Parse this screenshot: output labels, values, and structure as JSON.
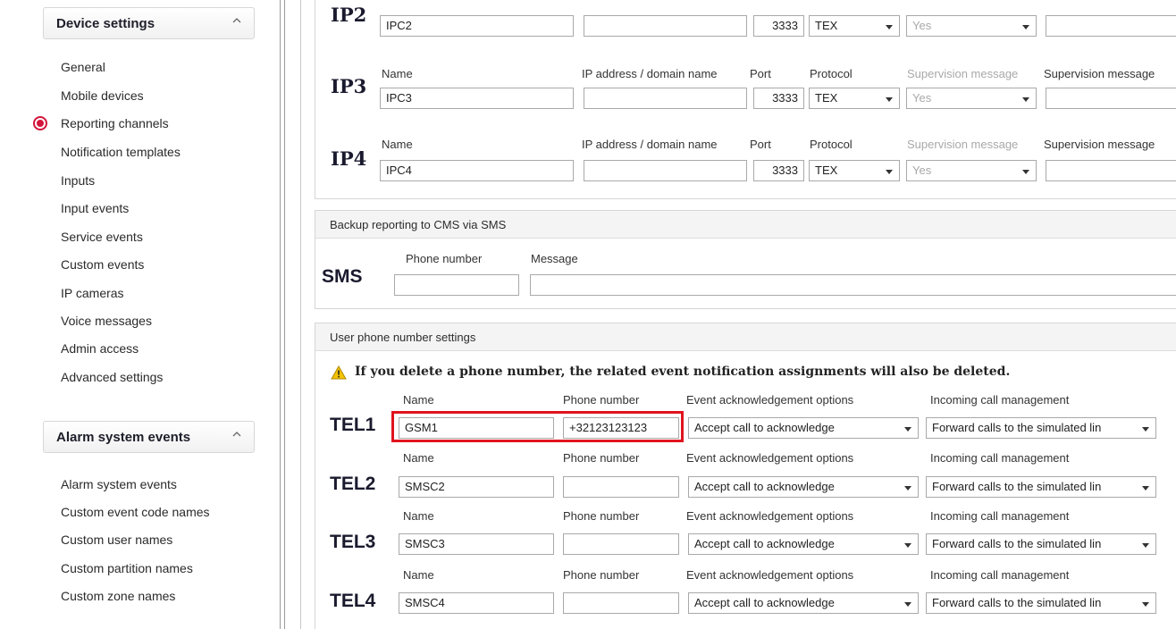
{
  "sidebar": {
    "device_header": "Device settings",
    "device_items": [
      "General",
      "Mobile devices",
      "Reporting channels",
      "Notification templates",
      "Inputs",
      "Input events",
      "Service events",
      "Custom events",
      "IP cameras",
      "Voice messages",
      "Admin access",
      "Advanced settings"
    ],
    "alarm_header": "Alarm system events",
    "alarm_items": [
      "Alarm system events",
      "Custom event code names",
      "Custom user names",
      "Custom partition names",
      "Custom zone names"
    ],
    "selected_item": "Reporting channels"
  },
  "ip_channels": {
    "col_name": "Name",
    "col_ip": "IP address / domain name",
    "col_port": "Port",
    "col_protocol": "Protocol",
    "col_supervision": "Supervision message",
    "col_supervision2": "Supervision message",
    "rows": [
      {
        "label": "IP2",
        "name": "IPC2",
        "ip": "",
        "port": "3333",
        "protocol": "TEX",
        "supervision": "Yes"
      },
      {
        "label": "IP3",
        "name": "IPC3",
        "ip": "",
        "port": "3333",
        "protocol": "TEX",
        "supervision": "Yes"
      },
      {
        "label": "IP4",
        "name": "IPC4",
        "ip": "",
        "port": "3333",
        "protocol": "TEX",
        "supervision": "Yes"
      }
    ]
  },
  "sms_backup": {
    "header": "Backup reporting to CMS via SMS",
    "label": "SMS",
    "col_phone": "Phone number",
    "col_message": "Message",
    "phone": "",
    "message": ""
  },
  "user_phones": {
    "header": "User phone number settings",
    "warning": "If you delete a phone number, the related event notification assignments will also be deleted.",
    "col_name": "Name",
    "col_phone": "Phone number",
    "col_ack": "Event acknowledgement options",
    "col_incoming": "Incoming call management",
    "rows": [
      {
        "label": "TEL1",
        "name": "GSM1",
        "phone": "+32123123123",
        "ack": "Accept call to acknowledge",
        "incoming": "Forward calls to the simulated lin"
      },
      {
        "label": "TEL2",
        "name": "SMSC2",
        "phone": "",
        "ack": "Accept call to acknowledge",
        "incoming": "Forward calls to the simulated lin"
      },
      {
        "label": "TEL3",
        "name": "SMSC3",
        "phone": "",
        "ack": "Accept call to acknowledge",
        "incoming": "Forward calls to the simulated lin"
      },
      {
        "label": "TEL4",
        "name": "SMSC4",
        "phone": "",
        "ack": "Accept call to acknowledge",
        "incoming": "Forward calls to the simulated lin"
      }
    ]
  },
  "colors": {
    "highlight": "#e0141e",
    "selected_radio": "#d4143c",
    "warning": "#f2c200"
  }
}
